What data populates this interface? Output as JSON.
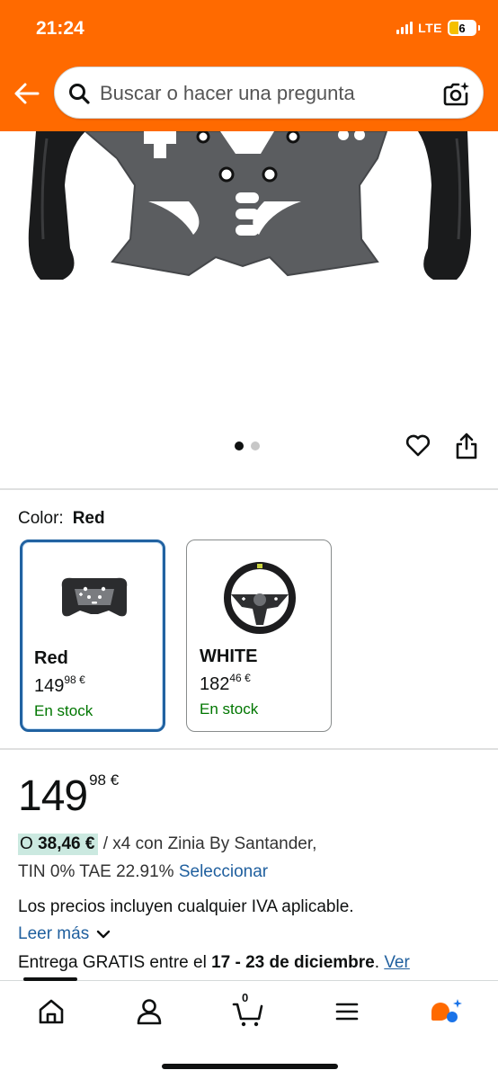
{
  "status_bar": {
    "time": "21:24",
    "network": "LTE",
    "battery": "6"
  },
  "search": {
    "placeholder": "Buscar o hacer una pregunta"
  },
  "carousel": {
    "total_images": 2,
    "active_index": 1
  },
  "color": {
    "label": "Color:",
    "selected": "Red",
    "options": [
      {
        "name": "Red",
        "price_whole": "149",
        "price_fraction": "98",
        "currency": "€",
        "stock": "En stock"
      },
      {
        "name": "WHITE",
        "price_whole": "182",
        "price_fraction": "46",
        "currency": "€",
        "stock": "En stock"
      }
    ]
  },
  "price": {
    "whole": "149",
    "fraction": "98",
    "currency": "€"
  },
  "financing": {
    "prefix": "O",
    "amount": "38,46 €",
    "suffix": "/ x4 con Zinia By Santander,",
    "rates": "TIN 0% TAE 22.91%",
    "select_link": "Seleccionar"
  },
  "vat": {
    "text": "Los precios incluyen cualquier IVA aplicable.",
    "read_more": "Leer más"
  },
  "delivery": {
    "prefix": "Entrega GRATIS entre el",
    "dates": "17 - 23 de diciembre",
    "period": ".",
    "link": "Ver"
  },
  "bottom_nav": {
    "items": [
      "home-icon",
      "account-icon",
      "cart-icon",
      "menu-icon",
      "rufus-icon"
    ],
    "cart_count": "0"
  },
  "colors": {
    "header": "#ff6a00",
    "link": "#1f5f9e",
    "stock": "#007600",
    "selected_border": "#2162a1",
    "finance_highlight": "#cbe9e0"
  }
}
